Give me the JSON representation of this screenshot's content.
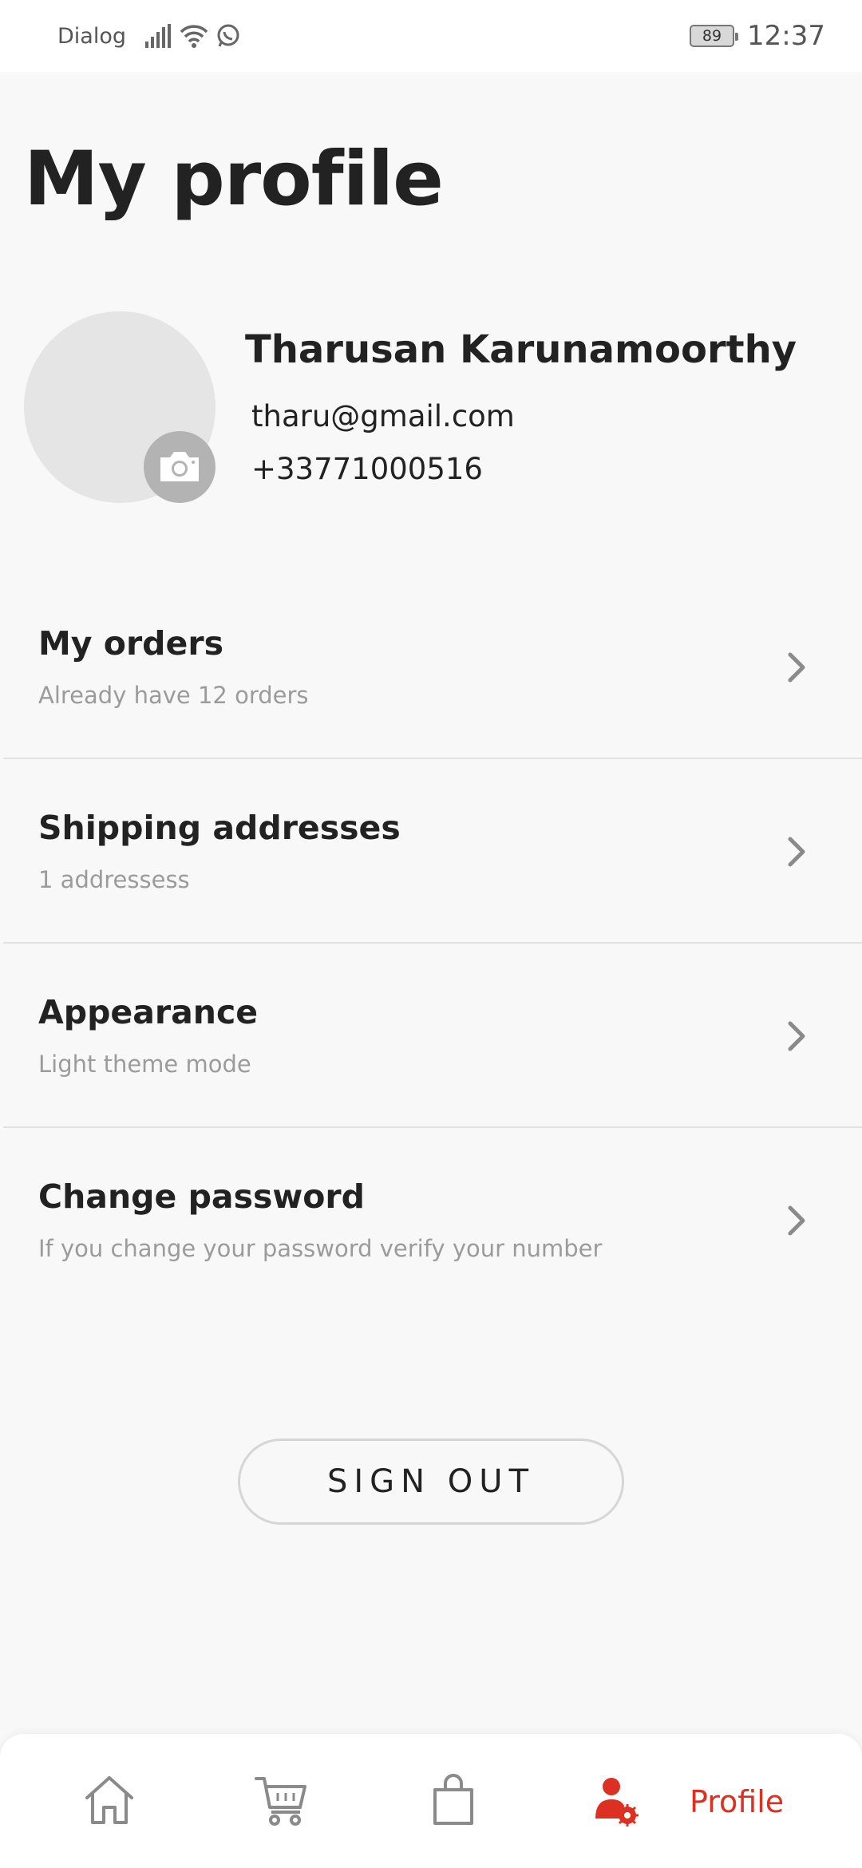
{
  "status_bar": {
    "carrier": "Dialog",
    "battery": "89",
    "time": "12:37"
  },
  "page": {
    "title": "My profile"
  },
  "user": {
    "name": "Tharusan Karunamoorthy",
    "email": "tharu@gmail.com",
    "phone": "+33771000516"
  },
  "menu": {
    "items": [
      {
        "title": "My orders",
        "subtitle": "Already have 12 orders"
      },
      {
        "title": "Shipping addresses",
        "subtitle": "1 addressess"
      },
      {
        "title": "Appearance",
        "subtitle": "Light theme mode"
      },
      {
        "title": "Change password",
        "subtitle": "If you change your password verify your number"
      }
    ]
  },
  "actions": {
    "sign_out": "SIGN OUT"
  },
  "bottom_nav": {
    "items": [
      {
        "icon": "home-icon"
      },
      {
        "icon": "cart-icon"
      },
      {
        "icon": "bag-icon"
      },
      {
        "icon": "profile-settings-icon",
        "label": "Profile",
        "active": true
      }
    ]
  },
  "colors": {
    "accent": "#db3022",
    "background": "#f8f8f8",
    "subtitle": "#9b9b9b"
  }
}
